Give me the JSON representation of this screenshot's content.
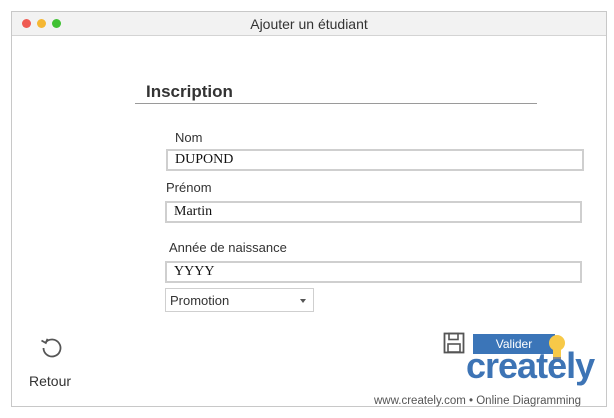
{
  "window": {
    "title": "Ajouter un étudiant"
  },
  "form": {
    "section_title": "Inscription",
    "nom": {
      "label": "Nom",
      "value": "DUPOND"
    },
    "prenom": {
      "label": "Prénom",
      "value": "Martin"
    },
    "naissance": {
      "label": "Année de naissance",
      "value": "YYYY"
    },
    "promotion": {
      "selected": "Promotion"
    }
  },
  "actions": {
    "back_label": "Retour",
    "validate_label": "Valider"
  },
  "watermark": {
    "brand": "creately",
    "tagline": "www.creately.com • Online Diagramming"
  },
  "colors": {
    "accent": "#3b75b8",
    "brand": "#3d74b5",
    "bulb": "#f7c948"
  },
  "icons": [
    "refresh-icon",
    "floppy-disk-icon",
    "lightbulb-icon",
    "chevron-down-icon"
  ]
}
